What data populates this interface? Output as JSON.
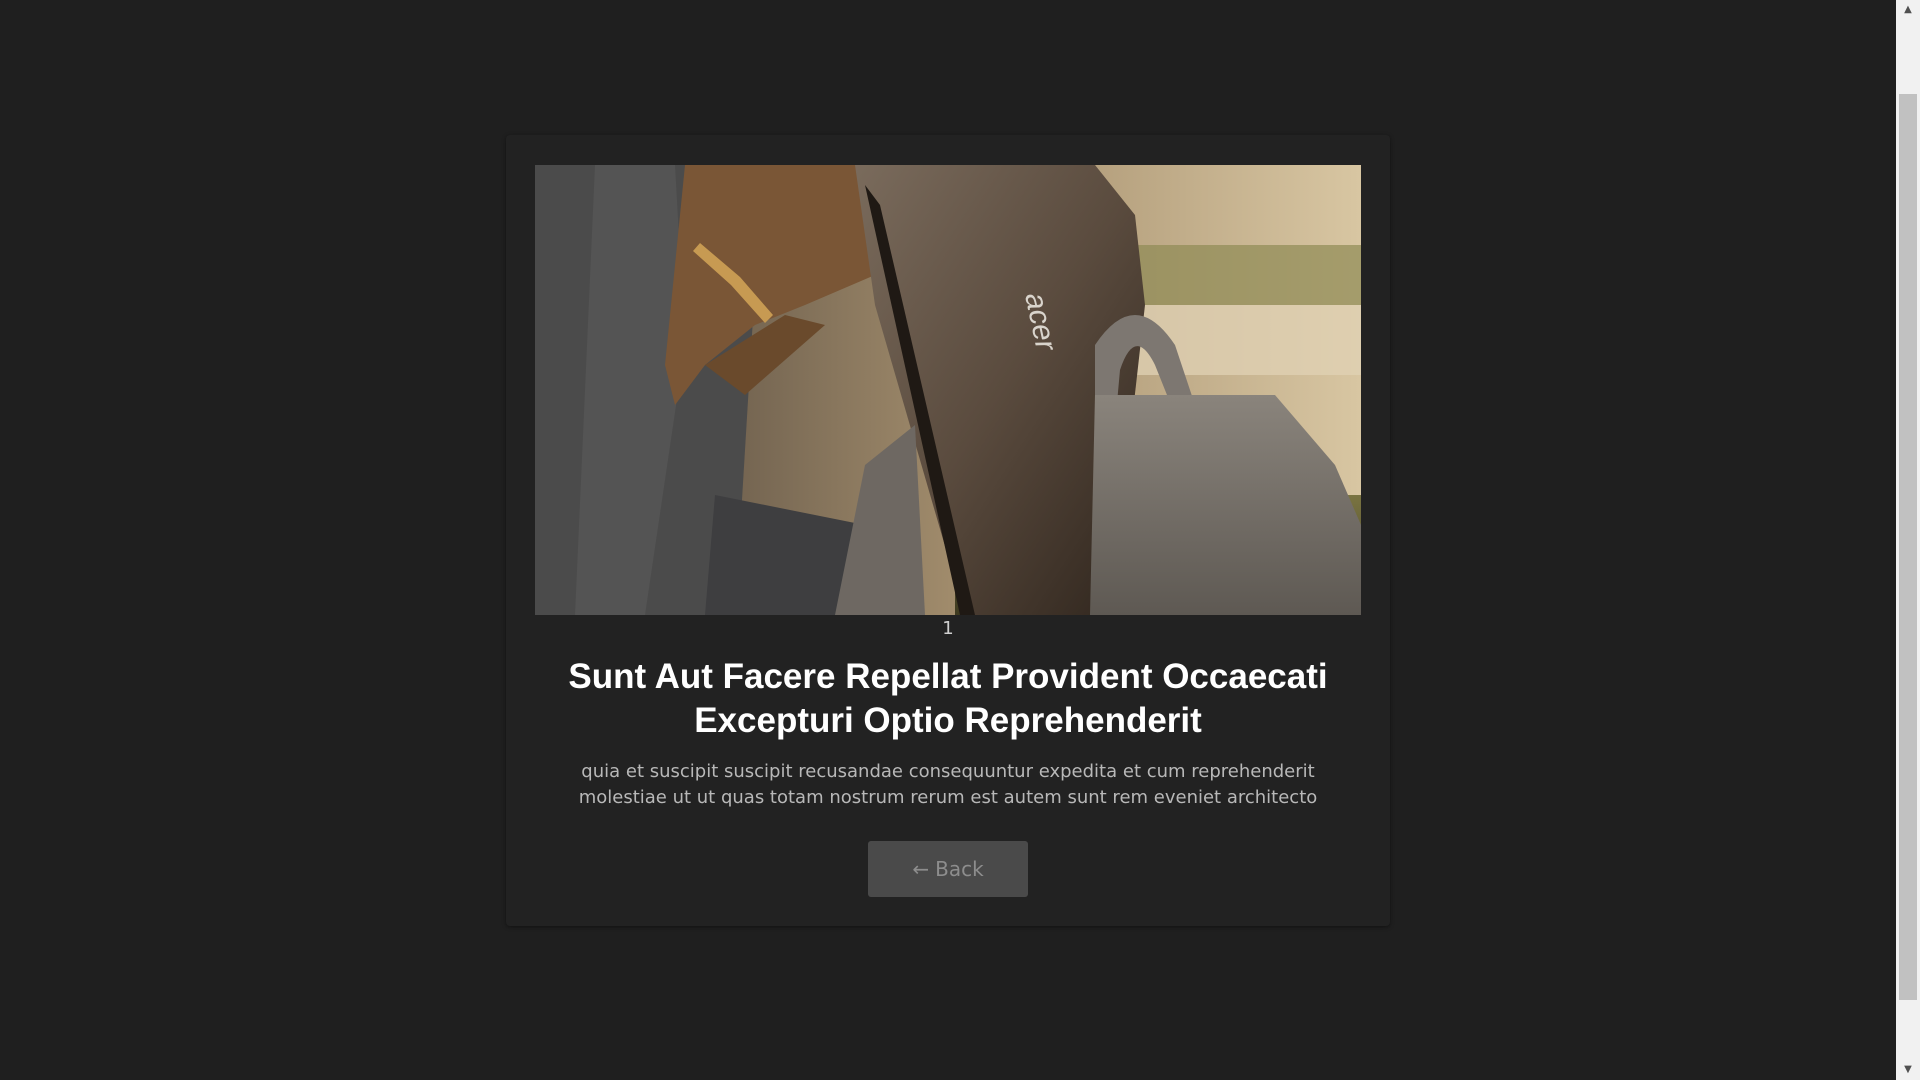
{
  "post": {
    "id": "1",
    "title": "Sunt Aut Facere Repellat Provident Occaecati Excepturi Optio Reprehenderit",
    "body": "quia et suscipit suscipit recusandae consequuntur expedita et cum reprehenderit molestiae ut ut quas totam nostrum rerum est autem sunt rem eveniet architecto",
    "image_brand_text": "acer"
  },
  "actions": {
    "back_icon": "←",
    "back_label": "Back"
  },
  "scrollbar": {
    "up_icon": "▲",
    "down_icon": "▼"
  },
  "colors": {
    "page_background": "#1f1f1f",
    "card_background": "#222222",
    "title": "#ffffff",
    "body_text": "#b8b8b8",
    "button_background": "#4a4a4a",
    "button_text": "#8d8d8d"
  }
}
